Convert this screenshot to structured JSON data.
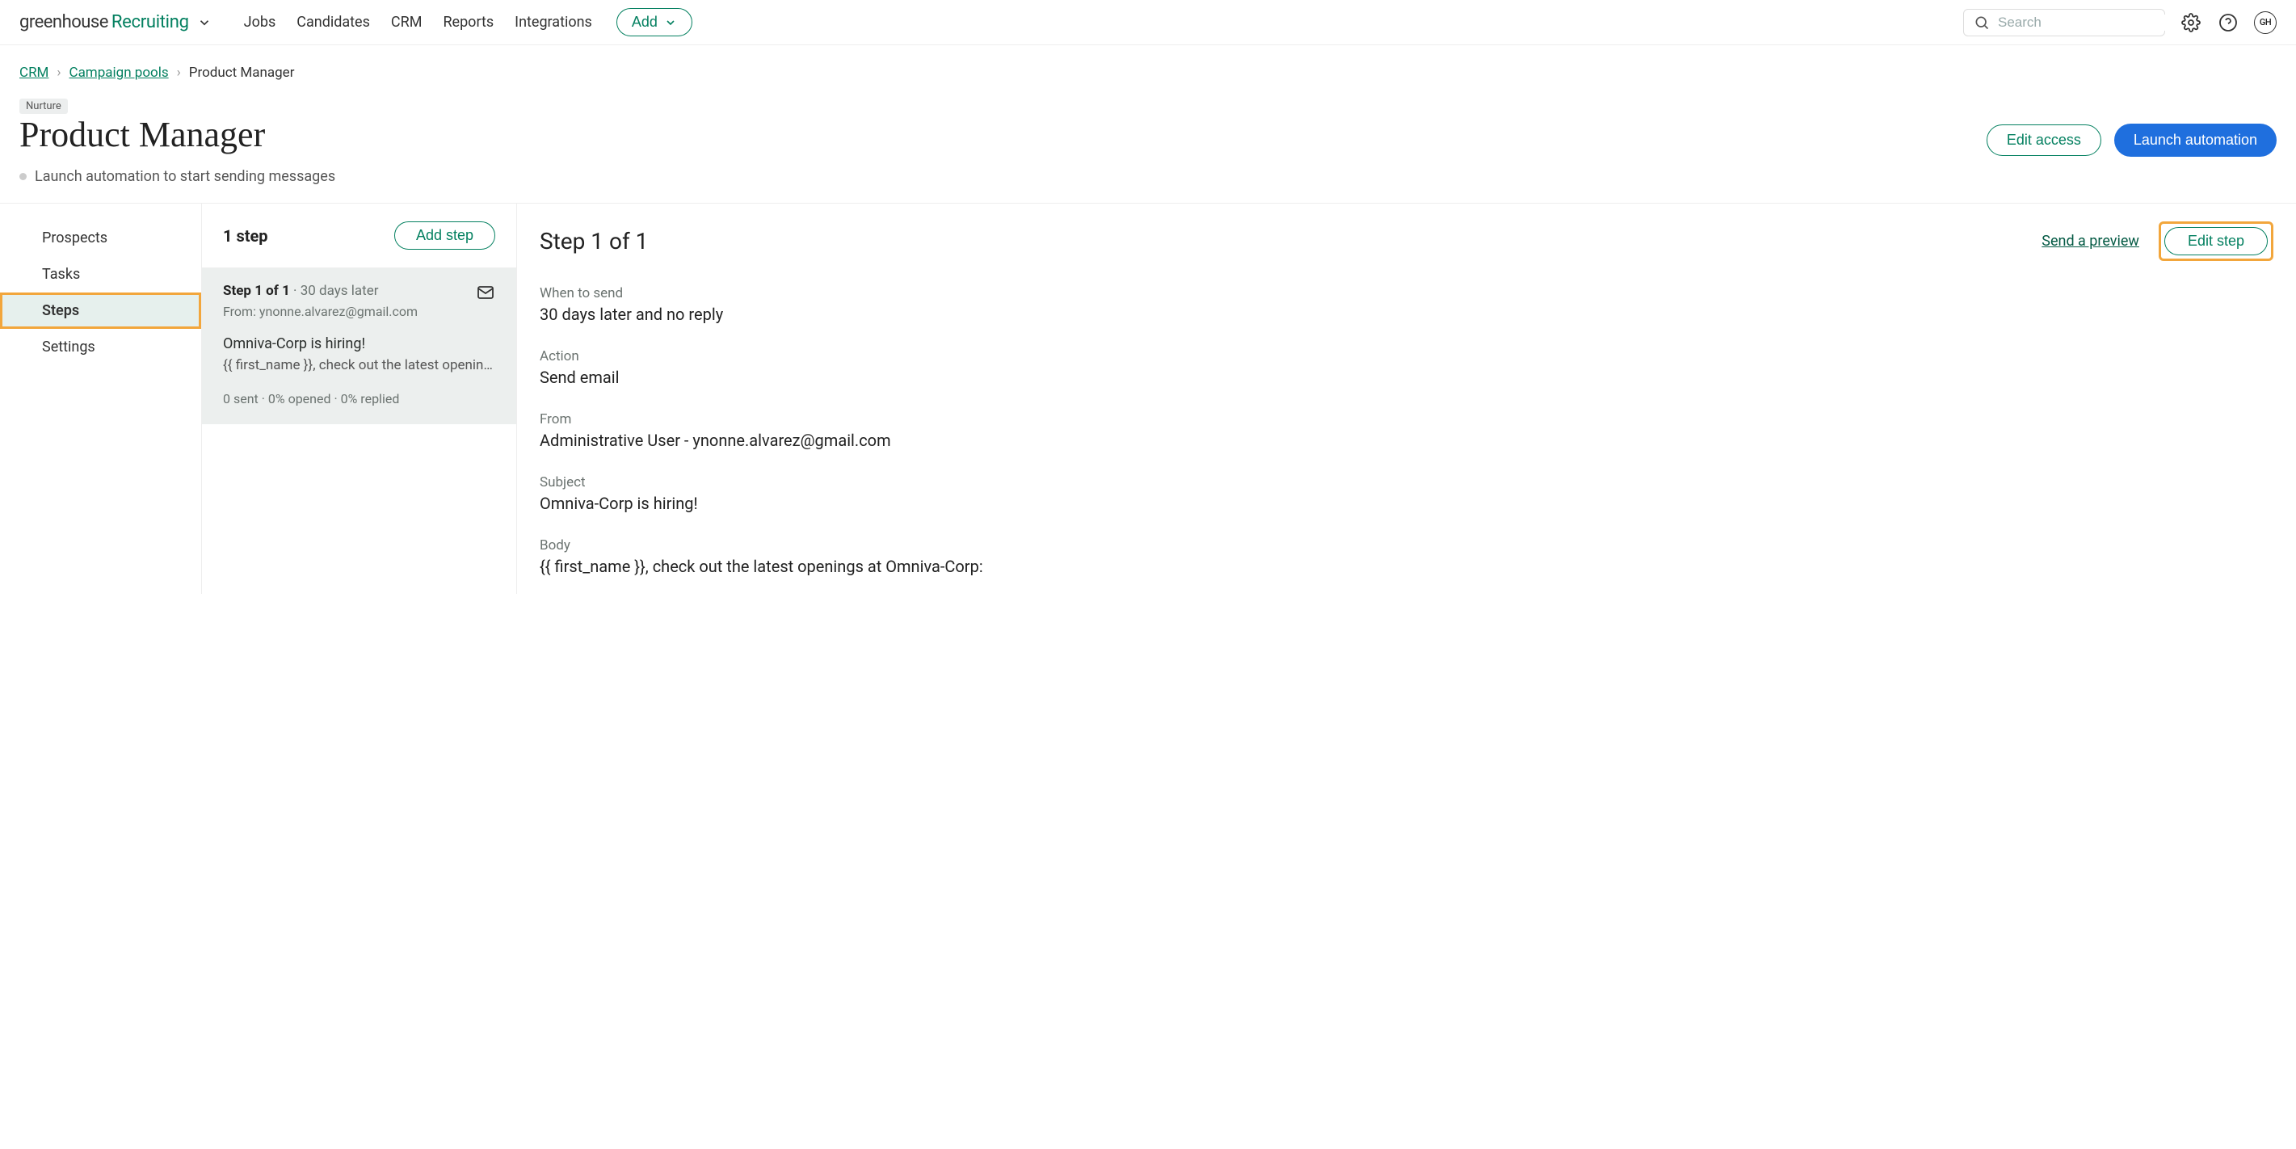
{
  "brand": {
    "part1": "greenhouse",
    "part2": "Recruiting"
  },
  "nav": {
    "jobs": "Jobs",
    "candidates": "Candidates",
    "crm": "CRM",
    "reports": "Reports",
    "integrations": "Integrations",
    "add": "Add"
  },
  "search": {
    "placeholder": "Search"
  },
  "avatar": "GH",
  "breadcrumb": {
    "crm": "CRM",
    "campaign_pools": "Campaign pools",
    "current": "Product Manager"
  },
  "badge": "Nurture",
  "page_title": "Product Manager",
  "status_text": "Launch automation to start sending messages",
  "actions": {
    "edit_access": "Edit access",
    "launch": "Launch automation"
  },
  "sidebar": {
    "items": [
      {
        "label": "Prospects"
      },
      {
        "label": "Tasks"
      },
      {
        "label": "Steps"
      },
      {
        "label": "Settings"
      }
    ],
    "active_index": 2
  },
  "steps_panel": {
    "count_label": "1 step",
    "add_step": "Add step",
    "step_card": {
      "step_num": "Step 1 of 1",
      "timing": "30 days later",
      "from_line": "From: ynonne.alvarez@gmail.com",
      "subject": "Omniva-Corp is hiring!",
      "body_preview": "{{ first_name }}, check out the latest opening…",
      "stats": "0 sent · 0% opened · 0% replied"
    }
  },
  "detail": {
    "title": "Step 1 of 1",
    "send_preview": "Send a preview",
    "edit_step": "Edit step",
    "sections": {
      "when_label": "When to send",
      "when_value": "30 days later and no reply",
      "action_label": "Action",
      "action_value": "Send email",
      "from_label": "From",
      "from_value": "Administrative User - ynonne.alvarez@gmail.com",
      "subject_label": "Subject",
      "subject_value": "Omniva-Corp is hiring!",
      "body_label": "Body",
      "body_value": "{{ first_name }}, check out the latest openings at Omniva-Corp:"
    }
  }
}
